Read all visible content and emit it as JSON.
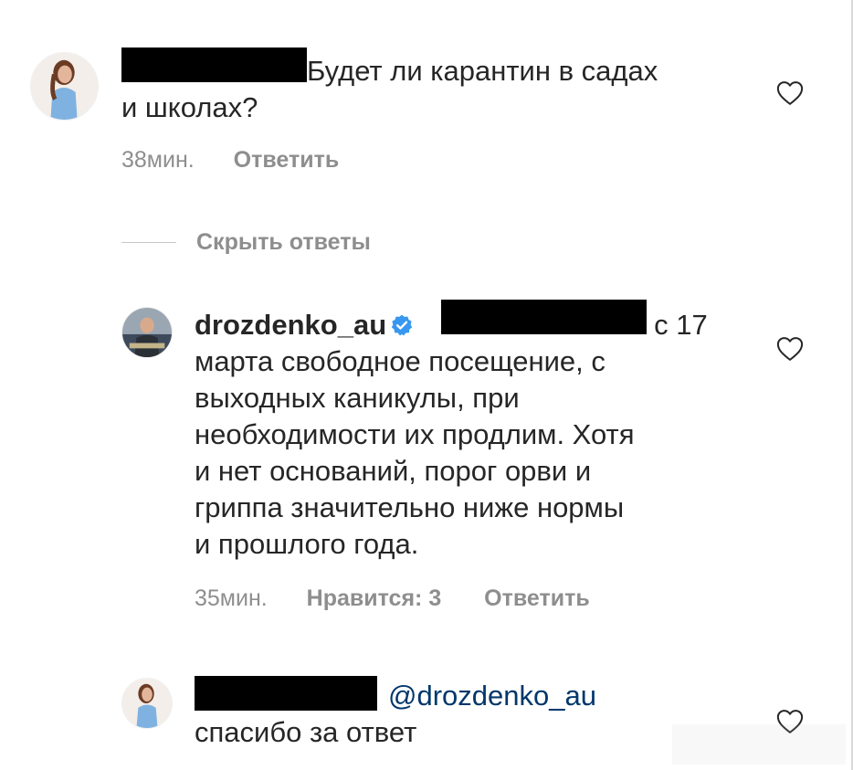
{
  "colors": {
    "text": "#262626",
    "meta": "#8e8e8e",
    "mention": "#00376b",
    "verified": "#3897f0",
    "redaction": "#000000"
  },
  "comment1": {
    "text_line1": "Будет ли карантин в садах",
    "text_line2": "и школах?",
    "time": "38мин.",
    "reply_label": "Ответить"
  },
  "hide_replies_label": "Скрыть ответы",
  "reply1": {
    "username": "drozdenko_au",
    "verified_icon": "verified-badge-icon",
    "text_after_redaction": "с 17",
    "lines": [
      "марта свободное посещение, с",
      "выходных каникулы, при",
      "необходимости их продлим. Хотя",
      "и нет оснований, порог орви и",
      "гриппа значительно ниже нормы",
      "и прошлого года."
    ],
    "time": "35мин.",
    "likes_label": "Нравится: 3",
    "reply_label": "Ответить"
  },
  "reply2": {
    "mention": "@drozdenko_au",
    "text": "спасибо за ответ"
  }
}
